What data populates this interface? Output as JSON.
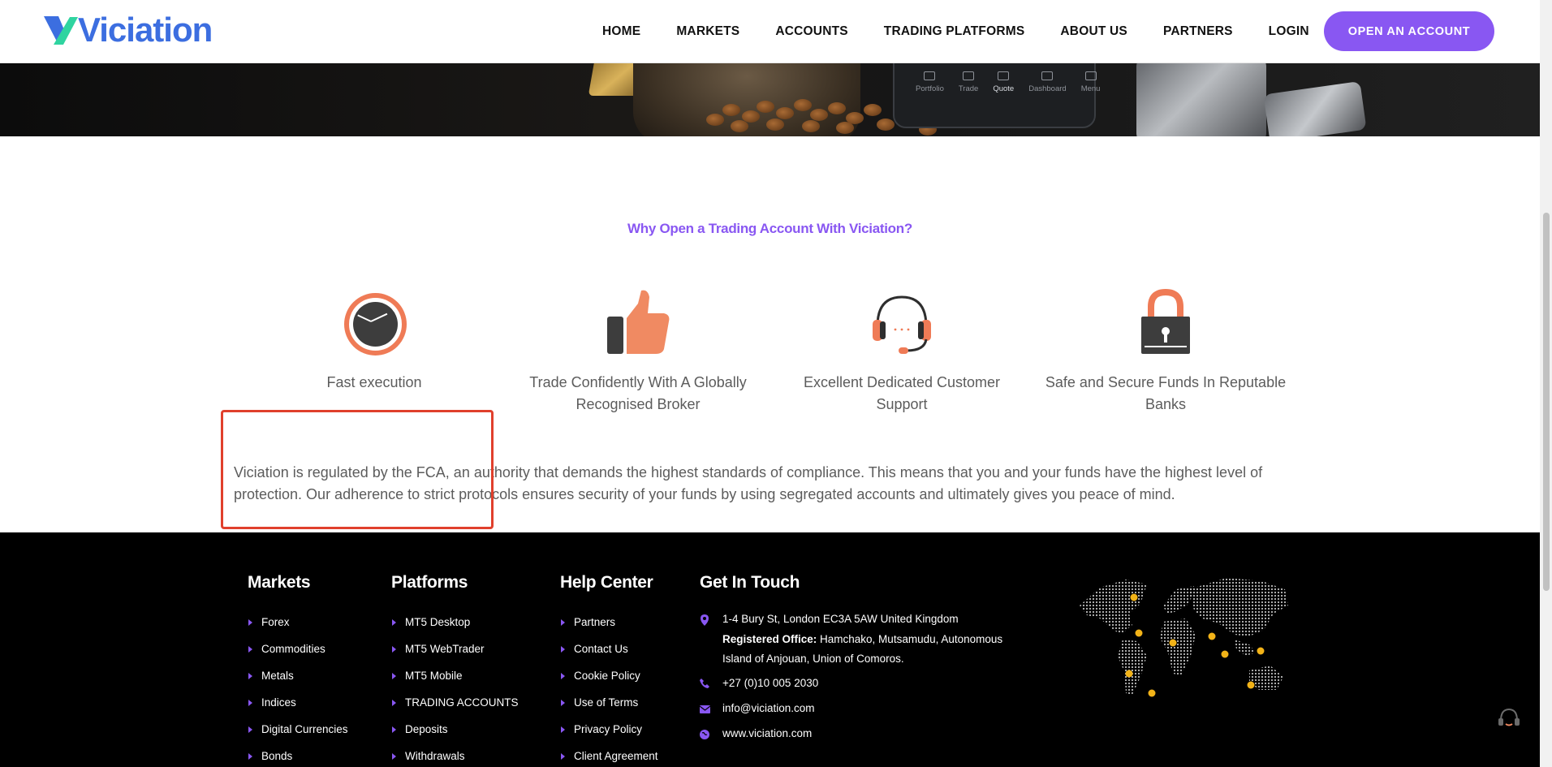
{
  "header": {
    "logo_text": "Viciation",
    "nav": [
      "HOME",
      "MARKETS",
      "ACCOUNTS",
      "TRADING PLATFORMS",
      "ABOUT US",
      "PARTNERS",
      "LOGIN"
    ],
    "cta_label": "OPEN AN ACCOUNT",
    "brand_color": "#8957f2",
    "logo_color": "#3c6ee0"
  },
  "hero": {
    "phone_nav": [
      "Portfolio",
      "Trade",
      "Quote",
      "Dashboard",
      "Menu"
    ]
  },
  "why": {
    "title": "Why Open a Trading Account With Viciation?",
    "features": [
      {
        "icon": "stopwatch-icon",
        "label": "Fast execution"
      },
      {
        "icon": "thumbs-up-icon",
        "label": "Trade Confidently With A Globally Recognised Broker"
      },
      {
        "icon": "headset-icon",
        "label": "Excellent Dedicated Customer Support"
      },
      {
        "icon": "padlock-icon",
        "label": "Safe and Secure Funds In Reputable Banks"
      }
    ],
    "paragraph": "Viciation is regulated by the FCA, an authority that demands the highest standards of compliance. This means that you and your funds have the highest level of protection. Our adherence to strict protocols ensures security of your funds by using segregated accounts and ultimately gives you peace of mind.",
    "accent_color": "#ef7b56"
  },
  "footer": {
    "markets": {
      "title": "Markets",
      "items": [
        "Forex",
        "Commodities",
        "Metals",
        "Indices",
        "Digital Currencies",
        "Bonds"
      ]
    },
    "platforms": {
      "title": "Platforms",
      "items": [
        "MT5 Desktop",
        "MT5 WebTrader",
        "MT5 Mobile",
        "TRADING ACCOUNTS",
        "Deposits",
        "Withdrawals"
      ]
    },
    "help": {
      "title": "Help Center",
      "items": [
        "Partners",
        "Contact Us",
        "Cookie Policy",
        "Use of Terms",
        "Privacy Policy",
        "Client Agreement"
      ]
    },
    "contact": {
      "title": "Get In Touch",
      "address": "1-4 Bury St, London EC3A 5AW United Kingdom",
      "registered_label": "Registered Office:",
      "registered_line1": " Hamchako, Mutsamudu, Autonomous",
      "registered_line2": "Island of Anjouan, Union of Comoros.",
      "phone": "+27 (0)10 005 2030",
      "email": "info@viciation.com",
      "website": "www.viciation.com"
    },
    "map_icon": "world-map-icon",
    "pin_color": "#f2b318"
  }
}
